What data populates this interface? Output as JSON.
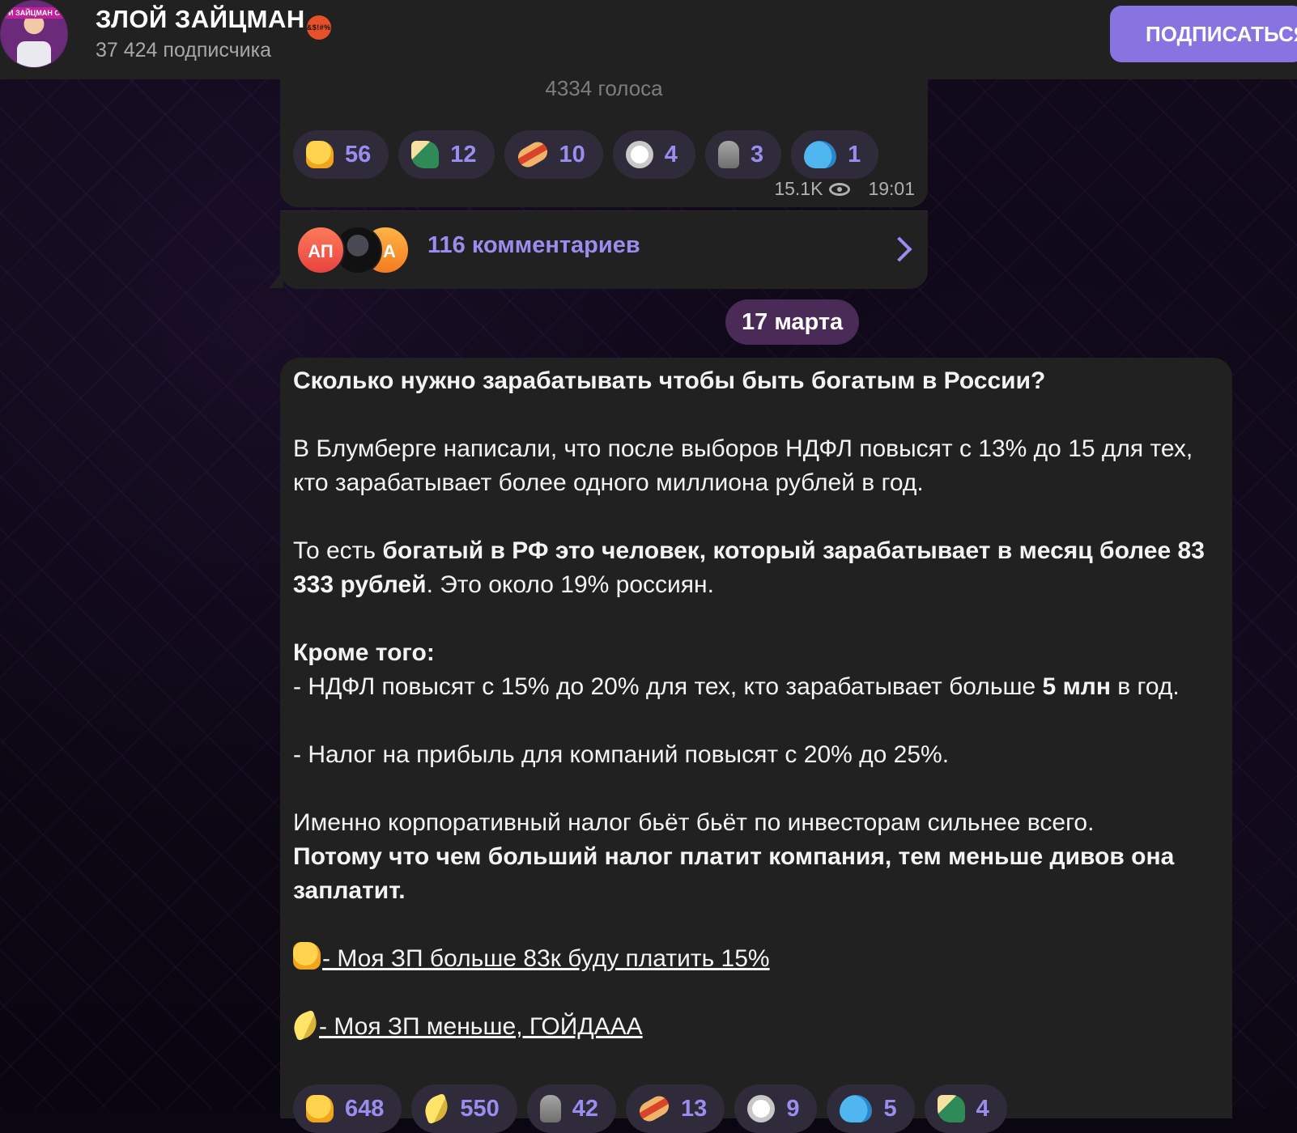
{
  "header": {
    "avatar_band_text": "И ЗАЙЦМАН С",
    "title": "ЗЛОЙ ЗАЙЦМАН",
    "title_emoji_text": "&$!#%",
    "subscribers": "37 424 подписчика",
    "subscribe_label": "ПОДПИСАТЬСЯ"
  },
  "prev_message": {
    "poll_votes": "4334 голоса",
    "reactions": [
      {
        "emoji": "thumbs-up",
        "count": "56"
      },
      {
        "emoji": "champagne",
        "count": "12"
      },
      {
        "emoji": "hotdog",
        "count": "10"
      },
      {
        "emoji": "dove",
        "count": "4"
      },
      {
        "emoji": "moai",
        "count": "3"
      },
      {
        "emoji": "whale",
        "count": "1"
      }
    ],
    "views": "15.1K",
    "time": "19:01",
    "comment_avatars": [
      "АП",
      "",
      "А"
    ],
    "comments_label": "116 комментариев"
  },
  "date_separator": "17 марта",
  "post": {
    "title": "Сколько нужно зарабатывать чтобы быть богатым в России?",
    "p1": "В Блумберге написали, что после выборов НДФЛ повысят с 13% до 15 для тех, кто зарабатывает более одного миллиона рублей в год.",
    "p2_prefix": "То есть ",
    "p2_bold": "богатый в РФ это человек, который зарабатывает в месяц более 83 333 рублей",
    "p2_suffix": ". Это около 19% россиян.",
    "p3_title": "Кроме того:",
    "p3_line1_prefix": "- НДФЛ повысят с 15% до 20% для тех, кто зарабатывает больше ",
    "p3_line1_bold": "5 млн",
    "p3_line1_suffix": " в год.",
    "p4": "- Налог на прибыль для компаний повысят с 20% до 25%.",
    "p5_line1": "Именно корпоративный налог бьёт бьёт по инвесторам сильнее всего.",
    "p5_bold": "Потому что чем больший налог платит компания, тем меньше дивов она заплатит.",
    "vote1": "- Моя ЗП больше 83к буду платить 15%",
    "vote2": "- Моя ЗП меньше, ГОЙДААА"
  },
  "post_reactions": [
    {
      "emoji": "thumbs-up",
      "count": "648"
    },
    {
      "emoji": "banana",
      "count": "550"
    },
    {
      "emoji": "moai",
      "count": "42"
    },
    {
      "emoji": "hotdog",
      "count": "13"
    },
    {
      "emoji": "dove",
      "count": "9"
    },
    {
      "emoji": "whale",
      "count": "5"
    },
    {
      "emoji": "champagne",
      "count": "4"
    }
  ],
  "colors": {
    "accent": "#8774e1",
    "reaction_text": "#9a8df0",
    "bubble": "#212121",
    "date_pill": "#4a2a56"
  }
}
